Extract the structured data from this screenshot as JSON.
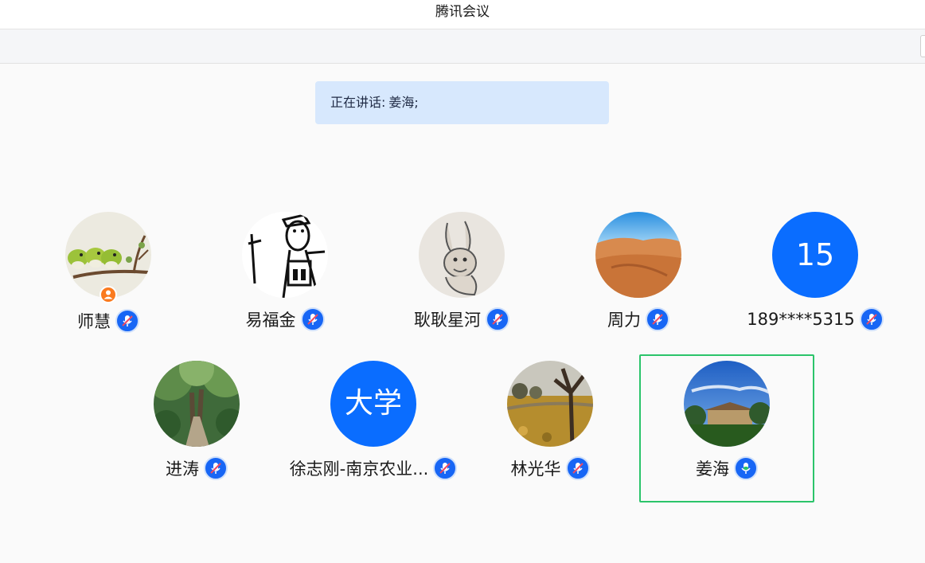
{
  "window": {
    "title": "腾讯会议"
  },
  "speaking": {
    "label": "正在讲话:",
    "names": "姜海;"
  },
  "participants": [
    {
      "name": "师慧",
      "avatar": "photo-birds",
      "host": true,
      "mic": "muted"
    },
    {
      "name": "易福金",
      "avatar": "photo-sketch-man",
      "mic": "muted"
    },
    {
      "name": "耿耿星河",
      "avatar": "photo-sketch-rabbit",
      "mic": "muted"
    },
    {
      "name": "周力",
      "avatar": "photo-desert",
      "mic": "muted"
    },
    {
      "name": "189****5315",
      "avatar": "text",
      "avatar_text": "15",
      "mic": "muted"
    },
    {
      "name": "进涛",
      "avatar": "photo-forest-path",
      "mic": "muted"
    },
    {
      "name": "徐志刚-南京农业...",
      "avatar": "text",
      "avatar_text": "大学",
      "mic": "muted"
    },
    {
      "name": "林光华",
      "avatar": "photo-autumn-tree",
      "mic": "muted"
    },
    {
      "name": "姜海",
      "avatar": "photo-campus",
      "mic": "speaking",
      "active": true
    }
  ],
  "colors": {
    "avatar_blue": "#0a6dff",
    "mic_blue": "#1766f5",
    "muted_slash": "#ef4a62",
    "speaking_mic": "#2bc46a",
    "active_border": "#2bc46a",
    "host_badge": "#fa7a1e",
    "banner_bg": "#d7e8fd"
  },
  "icons": {
    "muted": "mic-muted-icon",
    "speaking": "mic-speaking-icon",
    "host": "host-user-icon"
  }
}
